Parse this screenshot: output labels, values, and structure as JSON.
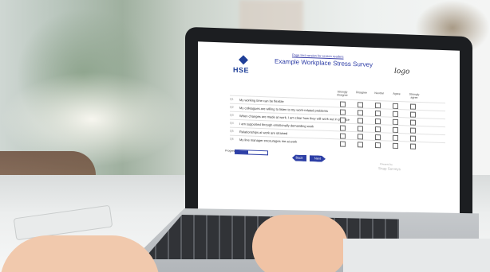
{
  "survey": {
    "link_text": "Page text version for screen readers",
    "title": "Example Workplace Stress Survey",
    "hse_text": "HSE",
    "logo_text": "logo",
    "columns": [
      "Strongly disagree",
      "Disagree",
      "Neutral",
      "Agree",
      "Strongly agree"
    ],
    "questions": [
      {
        "num": "Q1",
        "text": "My working time can be flexible"
      },
      {
        "num": "Q2",
        "text": "My colleagues are willing to listen to my work-related problems"
      },
      {
        "num": "Q3",
        "text": "When changes are made at work, I am clear how they will work out in practice"
      },
      {
        "num": "Q4",
        "text": "I am supported through emotionally demanding work"
      },
      {
        "num": "Q5",
        "text": "Relationships at work are strained"
      },
      {
        "num": "Q6",
        "text": "My line manager encourages me at work"
      }
    ],
    "progress_label": "Progress",
    "progress_fraction": 0.4,
    "back_label": "Back",
    "next_label": "Next",
    "powered_by": "Powered by",
    "brand": "Snap Surveys"
  }
}
